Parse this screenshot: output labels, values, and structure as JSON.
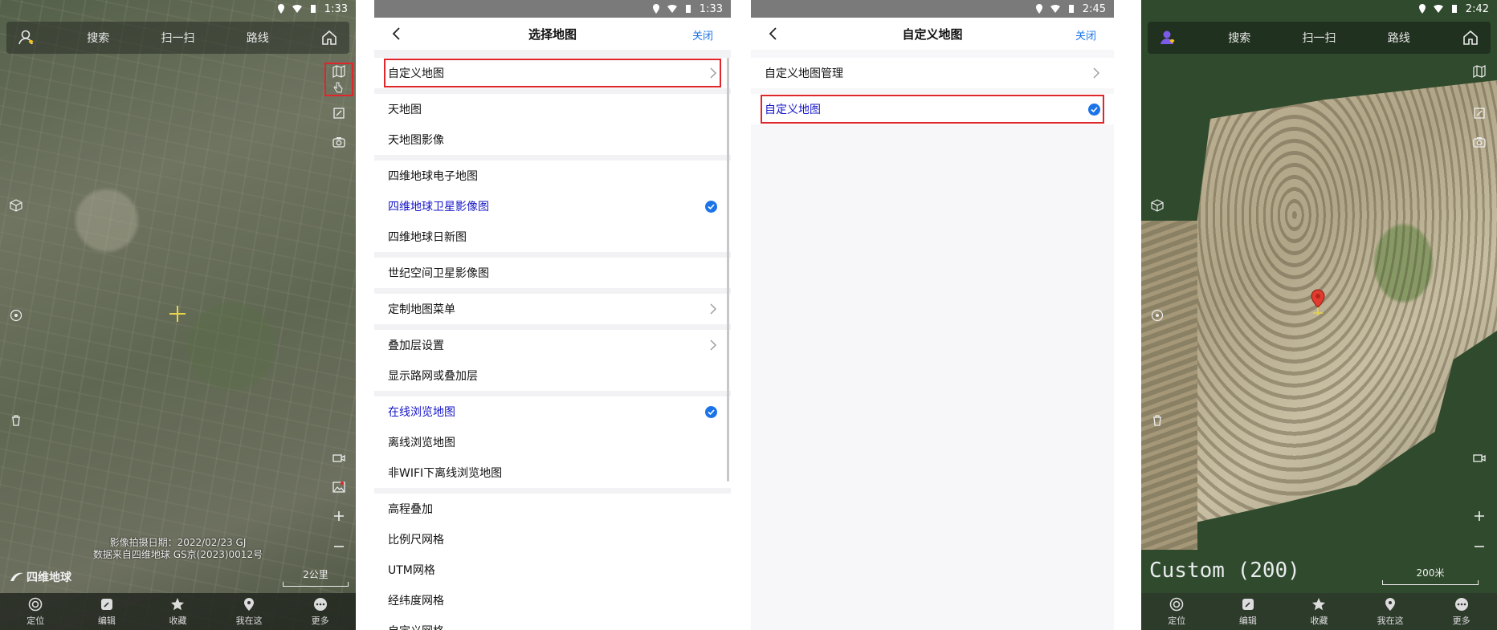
{
  "panel1": {
    "status_time": "1:33",
    "topbar": {
      "search": "搜索",
      "scan": "扫一扫",
      "route": "路线"
    },
    "attribution": {
      "line1": "影像拍摄日期：2022/02/23 GJ",
      "line2": "数据来自四维地球 GS京(2023)0012号"
    },
    "logo": "四维地球",
    "scale": "2公里",
    "nav": [
      "定位",
      "编辑",
      "收藏",
      "我在这",
      "更多"
    ]
  },
  "panel2": {
    "status_time": "1:33",
    "title": "选择地图",
    "close": "关闭",
    "groups": [
      [
        {
          "label": "自定义地图",
          "chevron": true,
          "highlight": true
        }
      ],
      [
        {
          "label": "天地图"
        },
        {
          "label": "天地图影像"
        }
      ],
      [
        {
          "label": "四维地球电子地图"
        },
        {
          "label": "四维地球卫星影像图",
          "selected": true
        },
        {
          "label": "四维地球日新图"
        }
      ],
      [
        {
          "label": "世纪空间卫星影像图"
        }
      ],
      [
        {
          "label": "定制地图菜单",
          "chevron": true
        }
      ],
      [
        {
          "label": "叠加层设置",
          "chevron": true
        },
        {
          "label": "显示路网或叠加层"
        }
      ],
      [
        {
          "label": "在线浏览地图",
          "selected": true
        },
        {
          "label": "离线浏览地图"
        },
        {
          "label": "非WIFI下离线浏览地图"
        }
      ],
      [
        {
          "label": "高程叠加"
        },
        {
          "label": "比例尺网格"
        },
        {
          "label": "UTM网格"
        },
        {
          "label": "经纬度网格"
        },
        {
          "label": "自定义网格"
        }
      ]
    ]
  },
  "panel3": {
    "status_time": "2:45",
    "title": "自定义地图",
    "close": "关闭",
    "rows": [
      {
        "label": "自定义地图管理",
        "chevron": true
      },
      {
        "label": "自定义地图",
        "selected": true,
        "highlight": true
      }
    ]
  },
  "panel4": {
    "status_time": "2:42",
    "topbar": {
      "search": "搜索",
      "scan": "扫一扫",
      "route": "路线"
    },
    "map_label": "Custom (200)",
    "scale": "200米",
    "nav": [
      "定位",
      "编辑",
      "收藏",
      "我在这",
      "更多"
    ]
  },
  "colors": {
    "accent_blue": "#1b73e8",
    "selected_text": "#1616c8",
    "highlight_red": "#e0262b"
  }
}
